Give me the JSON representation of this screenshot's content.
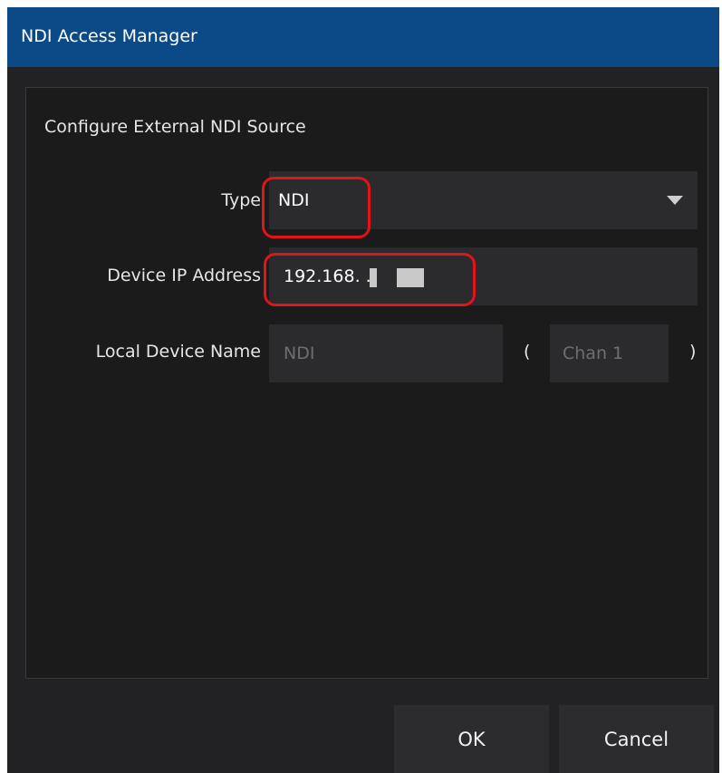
{
  "window": {
    "title": "NDI Access Manager"
  },
  "dialog": {
    "section_heading": "Configure External NDI Source",
    "type": {
      "label": "Type",
      "value": "NDI"
    },
    "device_ip": {
      "label": "Device IP Address",
      "value": "192.168.  ."
    },
    "local_device_name": {
      "label": "Local Device Name",
      "placeholder": "NDI"
    },
    "channel": {
      "open_paren": "(",
      "placeholder": "Chan 1",
      "close_paren": ")"
    }
  },
  "buttons": {
    "ok": "OK",
    "cancel": "Cancel"
  },
  "colors": {
    "titlebar": "#0b4a86",
    "background": "#222224",
    "panel": "#1b1b1c",
    "field": "#2b2b2d",
    "highlight": "#e3131a"
  },
  "icons": {
    "dropdown": "chevron-down-icon"
  }
}
